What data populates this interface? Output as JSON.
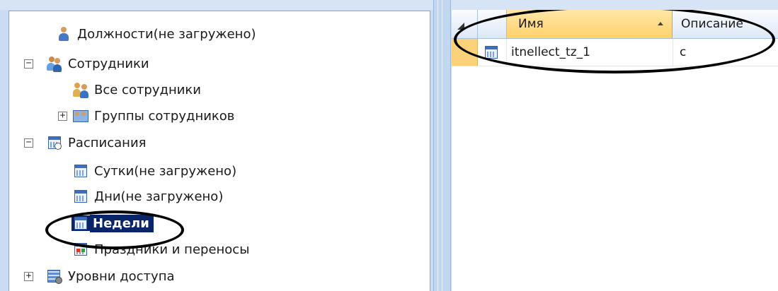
{
  "tree": {
    "items": [
      {
        "label": "Должности(не загружено)",
        "icon": "position-person-icon",
        "expander": ""
      },
      {
        "label": "Сотрудники",
        "icon": "employees-icon",
        "expander": "−"
      },
      {
        "label": "Все сотрудники",
        "icon": "all-employees-icon",
        "expander": ""
      },
      {
        "label": "Группы сотрудников",
        "icon": "employee-groups-icon",
        "expander": "+"
      },
      {
        "label": "Расписания",
        "icon": "schedules-icon",
        "expander": "−"
      },
      {
        "label": "Сутки(не загружено)",
        "icon": "calendar-icon",
        "expander": ""
      },
      {
        "label": "Дни(не загружено)",
        "icon": "calendar-icon",
        "expander": ""
      },
      {
        "label": "Недели",
        "icon": "calendar-icon",
        "expander": "",
        "selected": true
      },
      {
        "label": "Праздники и переносы",
        "icon": "holidays-calendar-icon",
        "expander": ""
      },
      {
        "label": "Уровни доступа",
        "icon": "access-levels-icon",
        "expander": "+"
      }
    ]
  },
  "grid": {
    "columns": {
      "name": "Имя",
      "description": "Описание"
    },
    "rows": [
      {
        "name": "itnellect_tz_1",
        "description": "c",
        "icon": "calendar-icon"
      }
    ]
  },
  "colors": {
    "selection": "#0a246a",
    "header_highlight": "#ffd26b",
    "annotation": "#000000"
  }
}
